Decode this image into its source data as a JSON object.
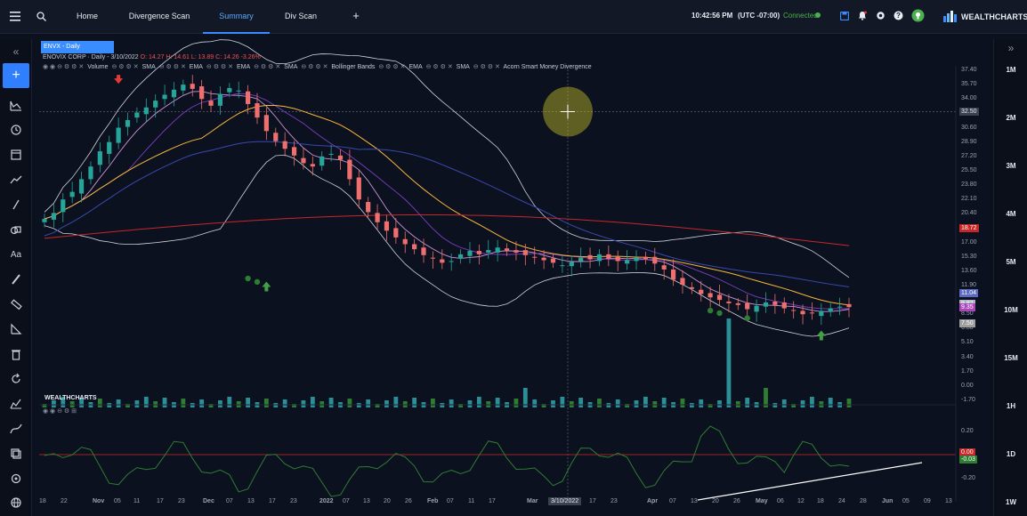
{
  "topbar": {
    "tabs": [
      {
        "label": "Home",
        "active": false
      },
      {
        "label": "Divergence Scan",
        "active": false
      },
      {
        "label": "Summary",
        "active": true
      },
      {
        "label": "Div Scan",
        "active": false
      }
    ],
    "time": "10:42:56 PM",
    "timezone": "(UTC -07:00)",
    "connection": "Connected",
    "brand": "WEALTHCHARTS",
    "colors": {
      "accent": "#3a8dff",
      "connected": "#4caf50"
    }
  },
  "chart": {
    "tab_label": "ENVX - Daily",
    "info": {
      "name": "ENOVIX CORP",
      "period": "Daily",
      "date": "3/10/2022",
      "o": "O: 14.27",
      "h": "H: 14.61",
      "l": "L: 13.89",
      "c": "C: 14.26",
      "change": "-3.26%"
    },
    "indicators": [
      "Volume",
      "SMA",
      "EMA",
      "EMA",
      "SMA",
      "Bollinger Bands",
      "EMA",
      "SMA",
      "Acorn Smart Money Divergence"
    ],
    "crosshair_price": "32.50",
    "crosshair_date": "3/10/2022",
    "price_ticks": [
      "37.40",
      "35.70",
      "34.00",
      "32.50",
      "30.60",
      "28.90",
      "27.20",
      "25.50",
      "23.80",
      "22.10",
      "20.40",
      "18.72",
      "17.00",
      "15.30",
      "13.60",
      "11.90",
      "9.35",
      "8.50",
      "7.50",
      "6.80",
      "5.10",
      "3.40",
      "1.70",
      "0.00",
      "-1.70"
    ],
    "price_tags": [
      {
        "label": "18.72",
        "color": "#c62828"
      },
      {
        "label": "11.04",
        "color": "#5c6bc0"
      },
      {
        "label": "9.82",
        "color": "#aab2c4"
      },
      {
        "label": "9.35",
        "color": "#ab47bc"
      },
      {
        "label": "7.50",
        "color": "#9e9e9e"
      }
    ],
    "osc_ticks": [
      "0.20",
      "0.00",
      "-0.20"
    ],
    "osc_tags": [
      {
        "label": "0.00",
        "color": "#c62828"
      },
      {
        "label": "-0.03",
        "color": "#2e7d32"
      }
    ],
    "date_ticks": [
      "18",
      "22",
      "Nov",
      "05",
      "11",
      "17",
      "23",
      "Dec",
      "07",
      "13",
      "17",
      "23",
      "2022",
      "07",
      "13",
      "20",
      "26",
      "Feb",
      "07",
      "11",
      "17",
      "Mar",
      "3/10/2022",
      "17",
      "23",
      "Apr",
      "07",
      "13",
      "20",
      "26",
      "May",
      "06",
      "12",
      "18",
      "24",
      "28",
      "Jun",
      "05",
      "09",
      "13"
    ],
    "watermark": "WEALTHCHARTS"
  },
  "timeframes_right": [
    "1M",
    "2M",
    "3M",
    "4M",
    "5M",
    "10M",
    "15M",
    "1H",
    "1D",
    "1W"
  ],
  "chart_data": {
    "type": "line",
    "title": "ENOVIX CORP - Daily",
    "x_start": "2021-10-18",
    "x_end": "2022-05-27",
    "ylim": [
      -1.7,
      37.4
    ],
    "series": [
      {
        "name": "ENVX",
        "values": [
          19.8,
          20.5,
          22.1,
          23.0,
          24.5,
          26.0,
          27.8,
          28.9,
          30.6,
          31.5,
          32.4,
          33.0,
          33.8,
          34.5,
          35.1,
          35.7,
          35.2,
          34.0,
          33.2,
          34.6,
          35.3,
          35.0,
          33.4,
          31.8,
          30.2,
          29.0,
          28.1,
          27.3,
          26.4,
          26.0,
          27.2,
          27.5,
          26.8,
          24.5,
          22.1,
          20.6,
          19.4,
          18.4,
          17.6,
          16.8,
          16.2,
          15.5,
          15.1,
          14.6,
          14.8,
          15.6,
          16.0,
          15.6,
          16.1,
          16.4,
          16.0,
          15.8,
          15.5,
          15.2,
          14.9,
          14.6,
          14.3,
          14.7,
          15.2,
          15.0,
          15.6,
          15.1,
          14.8,
          14.9,
          15.2,
          15.0,
          14.5,
          13.8,
          12.6,
          12.0,
          11.5,
          10.9,
          10.5,
          10.2,
          9.8,
          9.6,
          9.1,
          9.5,
          9.9,
          9.6,
          9.2,
          8.9,
          8.5,
          8.6,
          8.9,
          9.2,
          9.4,
          9.35
        ]
      }
    ]
  }
}
